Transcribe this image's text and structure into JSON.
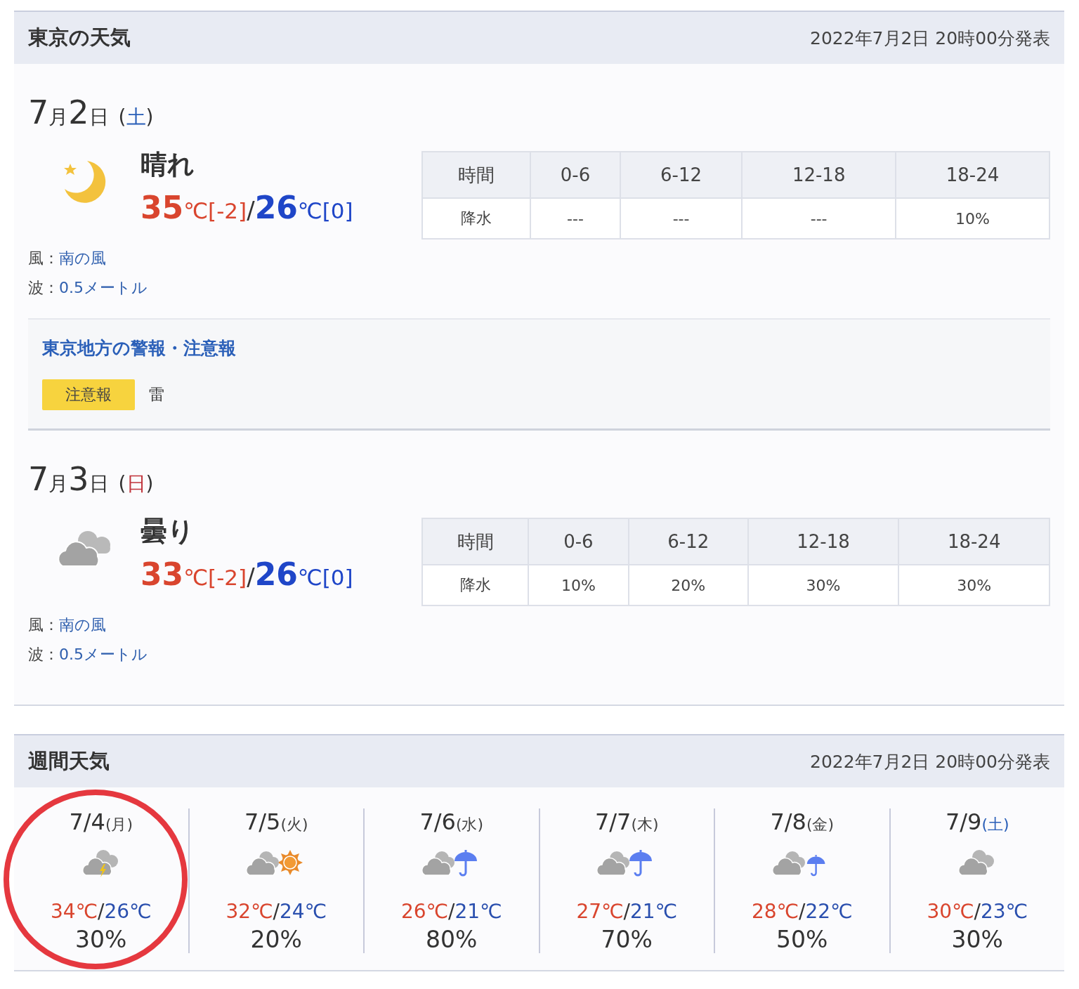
{
  "today_section": {
    "title": "東京の天気",
    "issued": "2022年7月2日 20時00分発表",
    "days": [
      {
        "month": "7",
        "month_unit": "月",
        "day": "2",
        "day_unit": "日",
        "weekday_open": "(",
        "weekday": "土",
        "color": "#2a5fb8",
        "weekday_close": ")",
        "kind": "moon",
        "weather": "晴れ",
        "high": {
          "value": "35",
          "unit": "℃",
          "diff": "[-2]"
        },
        "separator": "/",
        "low": {
          "value": "26",
          "unit": "℃",
          "diff": "[0]"
        },
        "table": {
          "header": [
            "時間",
            "0-6",
            "6-12",
            "12-18",
            "18-24"
          ],
          "row": [
            "降水",
            "---",
            "---",
            "---",
            "10%"
          ]
        },
        "wind_label": "風：",
        "wind": "南の風",
        "wave_label": "波：",
        "wave": "0.5メートル",
        "warnings": {
          "title": "東京地方の警報・注意報",
          "items": [
            {
              "badge": "注意報",
              "text": "雷"
            }
          ]
        }
      },
      {
        "month": "7",
        "month_unit": "月",
        "day": "3",
        "day_unit": "日",
        "weekday_open": "(",
        "weekday": "日",
        "color": "#c0343c",
        "weekday_close": ")",
        "kind": "cloudy",
        "weather": "曇り",
        "high": {
          "value": "33",
          "unit": "℃",
          "diff": "[-2]"
        },
        "separator": "/",
        "low": {
          "value": "26",
          "unit": "℃",
          "diff": "[0]"
        },
        "table": {
          "header": [
            "時間",
            "0-6",
            "6-12",
            "12-18",
            "18-24"
          ],
          "row": [
            "降水",
            "10%",
            "20%",
            "30%",
            "30%"
          ]
        },
        "wind_label": "風：",
        "wind": "南の風",
        "wave_label": "波：",
        "wave": "0.5メートル"
      }
    ]
  },
  "weekly_section": {
    "title": "週間天気",
    "issued": "2022年7月2日 20時00分発表",
    "days": [
      {
        "date": "7/4",
        "weekday": "(月)",
        "color": "#444444",
        "kind": "cloudy_thunder",
        "high": "34℃",
        "separator": "/",
        "low": "26℃",
        "pop": "30%",
        "highlighted": true
      },
      {
        "date": "7/5",
        "weekday": "(火)",
        "color": "#444444",
        "kind": "cloudy_sun",
        "high": "32℃",
        "separator": "/",
        "low": "24℃",
        "pop": "20%",
        "highlighted": false
      },
      {
        "date": "7/6",
        "weekday": "(水)",
        "color": "#444444",
        "kind": "cloudy_rain",
        "high": "26℃",
        "separator": "/",
        "low": "21℃",
        "pop": "80%",
        "highlighted": false
      },
      {
        "date": "7/7",
        "weekday": "(木)",
        "color": "#444444",
        "kind": "cloudy_rain",
        "high": "27℃",
        "separator": "/",
        "low": "21℃",
        "pop": "70%",
        "highlighted": false
      },
      {
        "date": "7/8",
        "weekday": "(金)",
        "color": "#444444",
        "kind": "cloudy_rain_small",
        "high": "28℃",
        "separator": "/",
        "low": "22℃",
        "pop": "50%",
        "highlighted": false
      },
      {
        "date": "7/9",
        "weekday": "(土)",
        "color": "#2a5fb8",
        "kind": "cloudy",
        "high": "30℃",
        "separator": "/",
        "low": "23℃",
        "pop": "30%",
        "highlighted": false
      }
    ]
  }
}
